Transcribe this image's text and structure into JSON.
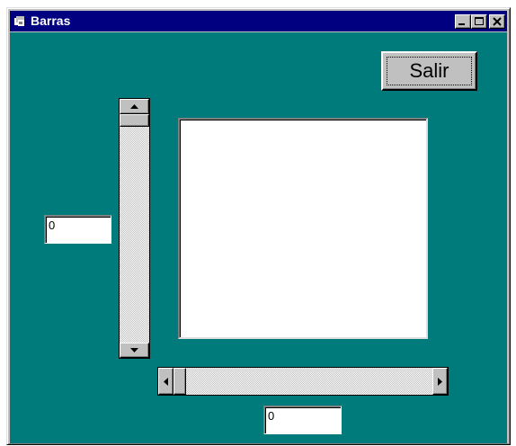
{
  "window": {
    "title": "Barras"
  },
  "buttons": {
    "salir_label": "Salir"
  },
  "inputs": {
    "vertical_value": "0",
    "horizontal_value": "0"
  },
  "vertical_scrollbar": {
    "value_fraction": 0
  },
  "horizontal_scrollbar": {
    "value_fraction": 0
  },
  "icons": {
    "app": "app-icon",
    "minimize": "minimize-icon",
    "maximize": "maximize-icon",
    "close": "close-icon",
    "up": "arrow-up-icon",
    "down": "arrow-down-icon",
    "left": "arrow-left-icon",
    "right": "arrow-right-icon"
  },
  "colors": {
    "titlebar": "#000080",
    "client_background": "#007b7b",
    "control_face": "#c0c0c0"
  }
}
